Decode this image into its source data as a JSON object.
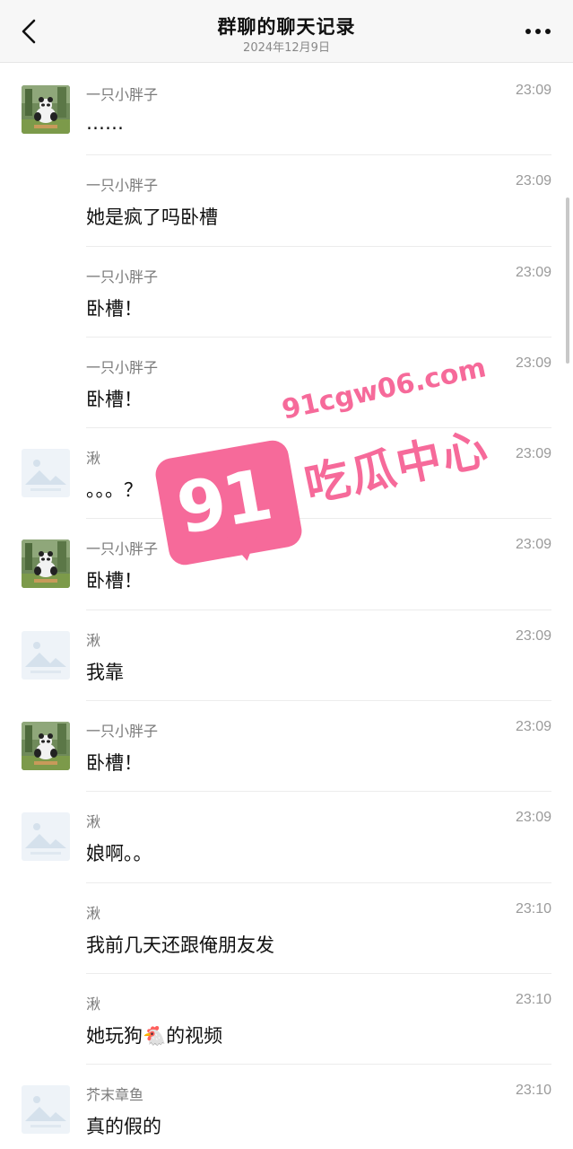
{
  "header": {
    "title": "群聊的聊天记录",
    "date": "2024年12月9日",
    "back_icon": "chevron-left-icon",
    "more_icon": "more-dots-icon"
  },
  "messages": [
    {
      "sender": "一只小胖子",
      "time": "23:09",
      "text": "……",
      "avatar": "panda"
    },
    {
      "sender": "一只小胖子",
      "time": "23:09",
      "text": "她是疯了吗卧槽",
      "avatar": "none"
    },
    {
      "sender": "一只小胖子",
      "time": "23:09",
      "text": "卧槽！",
      "avatar": "none"
    },
    {
      "sender": "一只小胖子",
      "time": "23:09",
      "text": "卧槽！",
      "avatar": "none"
    },
    {
      "sender": "湫",
      "time": "23:09",
      "text": "。。。？",
      "avatar": "placeholder"
    },
    {
      "sender": "一只小胖子",
      "time": "23:09",
      "text": "卧槽！",
      "avatar": "panda"
    },
    {
      "sender": "湫",
      "time": "23:09",
      "text": "我靠",
      "avatar": "placeholder"
    },
    {
      "sender": "一只小胖子",
      "time": "23:09",
      "text": "卧槽！",
      "avatar": "panda"
    },
    {
      "sender": "湫",
      "time": "23:09",
      "text": "娘啊。。",
      "avatar": "placeholder"
    },
    {
      "sender": "湫",
      "time": "23:10",
      "text": "我前几天还跟俺朋友发",
      "avatar": "none"
    },
    {
      "sender": "湫",
      "time": "23:10",
      "text": "她玩狗🐔的视频",
      "avatar": "none"
    },
    {
      "sender": "芥末章鱼",
      "time": "23:10",
      "text": "真的假的",
      "avatar": "placeholder"
    }
  ],
  "watermark": {
    "number": "91",
    "url": "91cgw06.com",
    "brand": "吃瓜中心"
  },
  "colors": {
    "navbar_bg": "#f7f7f7",
    "watermark_pink": "#f66a9a",
    "divider": "#ececec"
  }
}
